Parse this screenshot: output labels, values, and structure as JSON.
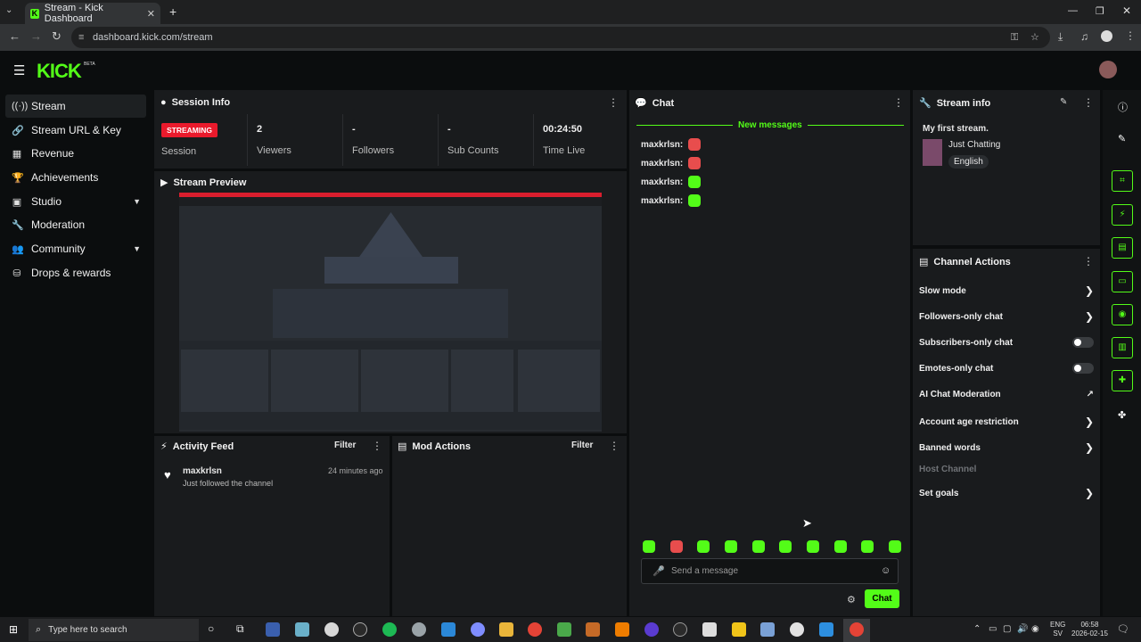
{
  "browser": {
    "tab_title": "Stream - Kick Dashboard",
    "url": "dashboard.kick.com/stream"
  },
  "brand": {
    "logo": "KICK",
    "badge": "BETA",
    "accent": "#53fc18"
  },
  "sidebar": {
    "items": [
      {
        "label": "Stream",
        "icon": "broadcast-icon"
      },
      {
        "label": "Stream URL & Key",
        "icon": "link-icon"
      },
      {
        "label": "Revenue",
        "icon": "chart-icon"
      },
      {
        "label": "Achievements",
        "icon": "trophy-icon"
      },
      {
        "label": "Studio",
        "icon": "grid-icon"
      },
      {
        "label": "Moderation",
        "icon": "wrench-icon"
      },
      {
        "label": "Community",
        "icon": "people-icon"
      },
      {
        "label": "Drops & rewards",
        "icon": "drops-icon"
      }
    ]
  },
  "session": {
    "title": "Session Info",
    "status": "STREAMING",
    "session_label": "Session",
    "stats": [
      {
        "value": "2",
        "label": "Viewers"
      },
      {
        "value": "-",
        "label": "Followers"
      },
      {
        "value": "-",
        "label": "Sub Counts"
      },
      {
        "value": "00:24:50",
        "label": "Time Live"
      }
    ]
  },
  "preview": {
    "title": "Stream Preview"
  },
  "activity": {
    "title": "Activity Feed",
    "filter": "Filter",
    "items": [
      {
        "user": "maxkrlsn",
        "text": "Just followed the channel",
        "time": "24 minutes ago"
      }
    ]
  },
  "mod": {
    "title": "Mod Actions",
    "filter": "Filter"
  },
  "chat": {
    "title": "Chat",
    "new_messages": "New messages",
    "messages": [
      "maxkrlsn:",
      "maxkrlsn:",
      "maxkrlsn:",
      "maxkrlsn:"
    ],
    "placeholder": "Send a message",
    "send": "Chat"
  },
  "stream_info": {
    "title": "Stream info",
    "stream_title": "My first stream.",
    "category": "Just Chatting",
    "language": "English"
  },
  "channel_actions": {
    "title": "Channel Actions",
    "items": [
      {
        "label": "Slow mode"
      },
      {
        "label": "Followers-only chat"
      },
      {
        "label": "Subscribers-only chat"
      },
      {
        "label": "Emotes-only chat"
      },
      {
        "label": "AI Chat Moderation"
      },
      {
        "label": "Account age restriction"
      },
      {
        "label": "Banned words"
      },
      {
        "label": "Host Channel"
      },
      {
        "label": "Set goals"
      }
    ]
  },
  "taskbar": {
    "search": "Type here to search",
    "lang": "ENG",
    "region": "SV",
    "time": "06:58",
    "date": "2026-02-15"
  }
}
